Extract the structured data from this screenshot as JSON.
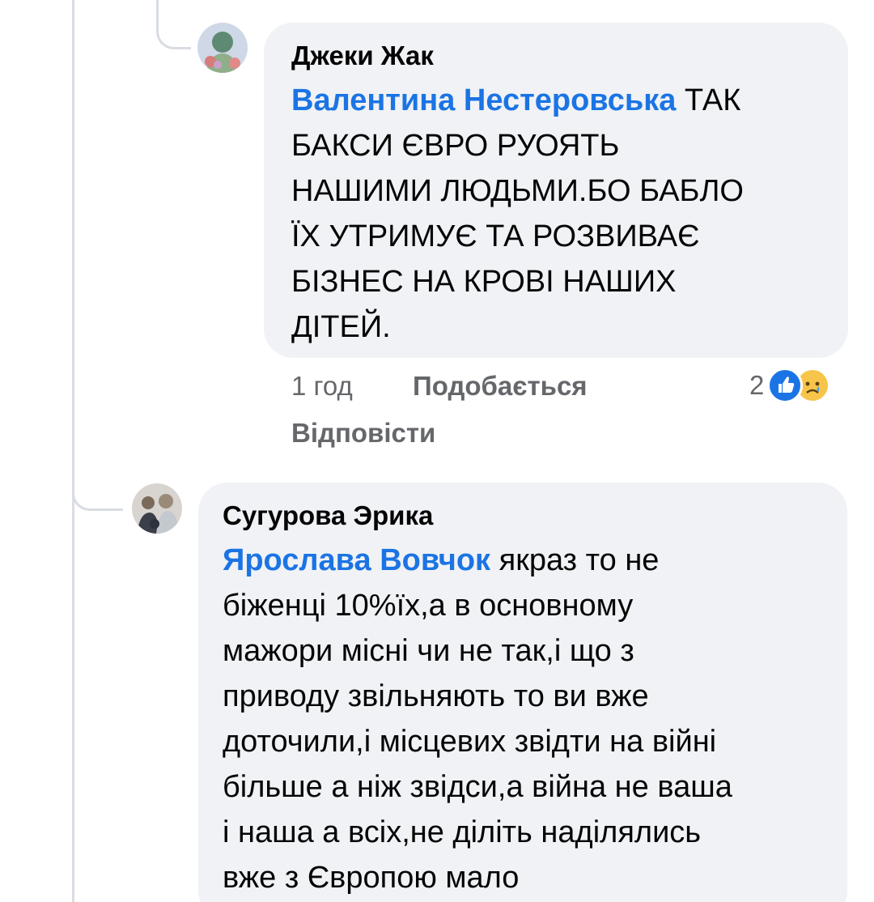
{
  "comments": [
    {
      "author": "Джеки Жак",
      "mention": "Валентина Нестеровська",
      "lines": [
        "ТАК",
        "БАКСИ ЄВРО РУОЯТЬ",
        "НАШИМИ ЛЮДЬМИ.БО БАБЛО",
        "ЇХ УТРИМУЄ ТА РОЗВИВАЄ",
        "БІЗНЕС НА КРОВІ НАШИХ",
        "ДІТЕЙ."
      ],
      "time": "1 год",
      "like_label": "Подобається",
      "reply_label": "Відповісти",
      "reaction_count": "2"
    },
    {
      "author": "Сугурова Эрика",
      "mention": "Ярослава Вовчок",
      "lines": [
        "якраз то не",
        "біженці 10%їх,а в основному",
        "мажори місні чи не так,і що з",
        "приводу звільняють то ви вже",
        "доточили,і місцевих звідти на війні",
        "більше а ніж звідси,а війна не ваша",
        "і наша а всіх,не діліть наділялись",
        "вже з Європою мало"
      ]
    }
  ],
  "colors": {
    "mention": "#1b74e4",
    "bubble": "#f0f2f5",
    "meta": "#65676b"
  },
  "icons": [
    "like-reaction-icon",
    "sad-reaction-icon"
  ]
}
